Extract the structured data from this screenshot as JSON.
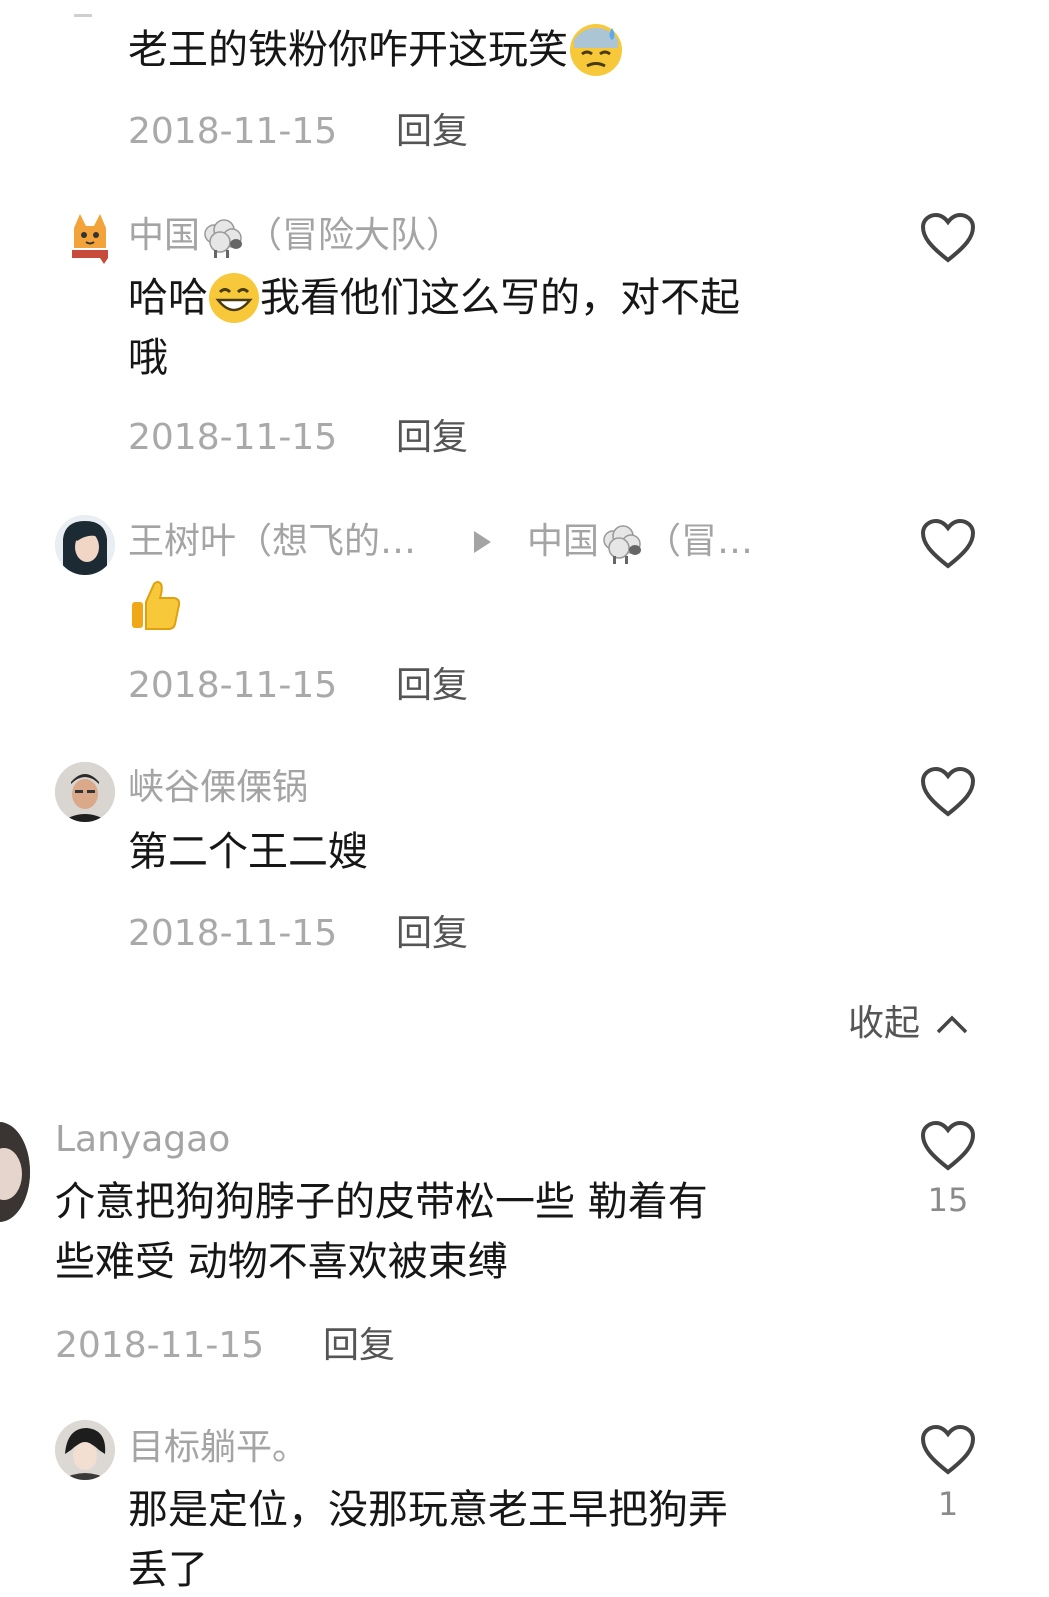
{
  "comments": [
    {
      "text": "老王的铁粉你咋开这玩笑",
      "emoji": "sweat-icon",
      "date": "2018-11-15",
      "reply": "回复"
    },
    {
      "username": "中国",
      "username_suffix": "（冒险大队）",
      "emoji_name": "sheep-icon",
      "text_a": "哈哈",
      "emoji": "grin-icon",
      "text_b": "我看他们这么写的，对不起",
      "text_c": "哦",
      "date": "2018-11-15",
      "reply": "回复"
    },
    {
      "username": "王树叶（想飞的…",
      "reply_to": "中国",
      "reply_to_suffix": "（冒…",
      "emoji": "thumbs-up-icon",
      "date": "2018-11-15",
      "reply": "回复"
    },
    {
      "username": "峡谷傈傈锅",
      "text": "第二个王二嫂",
      "date": "2018-11-15",
      "reply": "回复"
    },
    {
      "username": "Lanyagao",
      "text_line1": "介意把狗狗脖子的皮带松一些  勒着有",
      "text_line2": "些难受  动物不喜欢被束缚",
      "date": "2018-11-15",
      "reply": "回复",
      "likes": "15"
    },
    {
      "username": "目标躺平。",
      "text_line1": "那是定位，没那玩意老王早把狗弄",
      "text_line2": "丢了",
      "likes": "1"
    }
  ],
  "collapse_label": "收起",
  "colors": {
    "text": "#161616",
    "meta": "#a9a9a9",
    "reply": "#555555",
    "icon": "#444444"
  }
}
